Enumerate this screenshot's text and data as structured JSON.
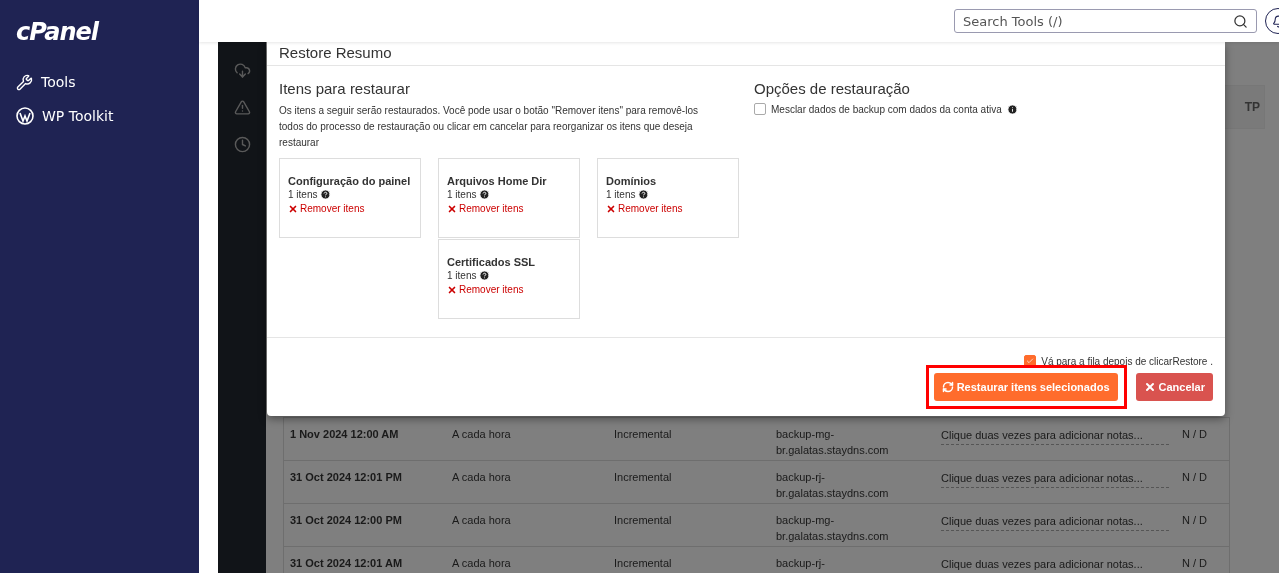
{
  "sidebar": {
    "logo": "cPanel",
    "items": [
      {
        "label": "Tools",
        "kind": "tools"
      },
      {
        "label": "WP Toolkit",
        "kind": "wordpress"
      }
    ]
  },
  "header": {
    "search": {
      "placeholder": "Search Tools (/)"
    }
  },
  "background": {
    "side_button": "TP",
    "rows": [
      {
        "date": "1 Nov 2024 12:00 AM",
        "frequency": "A cada hora",
        "type": "Incremental",
        "destination": "backup-mg-br.galatas.staydns.com",
        "notes": "Clique duas vezes para adicionar notas...",
        "status": "N / D"
      },
      {
        "date": "31 Oct 2024 12:01 PM",
        "frequency": "A cada hora",
        "type": "Incremental",
        "destination": "backup-rj-br.galatas.staydns.com",
        "notes": "Clique duas vezes para adicionar notas...",
        "status": "N / D"
      },
      {
        "date": "31 Oct 2024 12:00 PM",
        "frequency": "A cada hora",
        "type": "Incremental",
        "destination": "backup-mg-br.galatas.staydns.com",
        "notes": "Clique duas vezes para adicionar notas...",
        "status": "N / D"
      },
      {
        "date": "31 Oct 2024 12:01 AM",
        "frequency": "A cada hora",
        "type": "Incremental",
        "destination": "backup-rj-",
        "notes": "Clique duas vezes para adicionar notas...",
        "status": "N / D"
      }
    ]
  },
  "modal": {
    "title": "Restore Resumo",
    "items_section": {
      "heading": "Itens para restaurar",
      "description": "Os itens a seguir serão restaurados. Você pode usar o botão \"Remover itens\" para removê-los todos do processo de restauração ou clicar em cancelar para reorganizar os itens que deseja restaurar",
      "items": [
        {
          "title": "Configuração do painel",
          "count": "1 itens",
          "remove": "Remover itens"
        },
        {
          "title": "Arquivos Home Dir",
          "count": "1 itens",
          "remove": "Remover itens"
        },
        {
          "title": "Domínios",
          "count": "1 itens",
          "remove": "Remover itens"
        },
        {
          "title": "Certificados SSL",
          "count": "1 itens",
          "remove": "Remover itens"
        }
      ]
    },
    "options_section": {
      "heading": "Opções de restauração",
      "options": [
        {
          "label": "Mesclar dados de backup com dados da conta ativa",
          "checked": false
        }
      ]
    },
    "footer": {
      "queue_option": {
        "label": "Vá para a fila depois de clicarRestore .",
        "checked": true
      },
      "buttons": [
        {
          "label": "Restaurar itens selecionados",
          "kind": "primary",
          "highlighted": true
        },
        {
          "label": "Cancelar",
          "kind": "danger",
          "highlighted": false
        }
      ]
    }
  }
}
